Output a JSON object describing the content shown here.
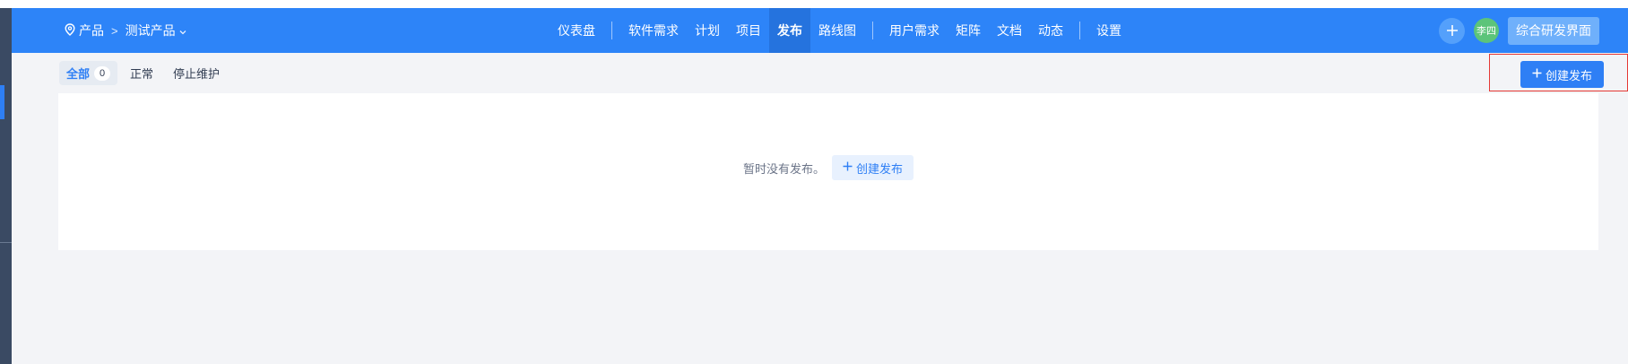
{
  "colors": {
    "topbar": "#2d84f8",
    "primary": "#2e7ff5",
    "avatar": "#5cc47a",
    "highlight": "#e53935",
    "page_bg": "#f3f4f7"
  },
  "breadcrumb": {
    "root_icon": "location-pin-icon",
    "root": "产品",
    "separator": ">",
    "current": "测试产品",
    "current_icon": "chevron-down-icon"
  },
  "nav": {
    "items": [
      "仪表盘",
      "软件需求",
      "计划",
      "项目",
      "发布",
      "路线图",
      "用户需求",
      "矩阵",
      "文档",
      "动态",
      "设置"
    ],
    "active": "发布"
  },
  "toolbar": {
    "plus_icon": "plus-icon",
    "avatar": "李四",
    "workspace": "综合研发界面"
  },
  "tabs": {
    "all_label": "全部",
    "all_count": "0",
    "normal_label": "正常",
    "terminated_label": "停止维护"
  },
  "actions": {
    "create_release": "创建发布"
  },
  "empty_state": {
    "message": "暂时没有发布。",
    "create_label": "创建发布"
  }
}
